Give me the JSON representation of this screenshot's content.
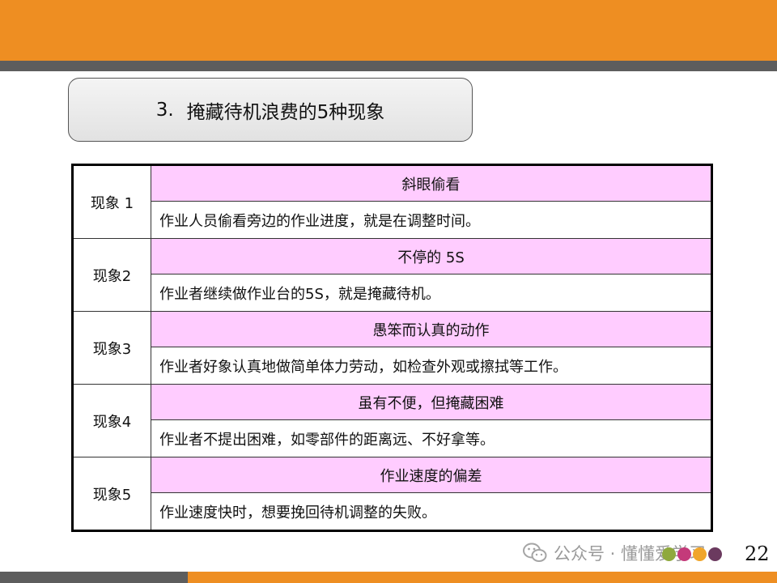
{
  "slide": {
    "title_number": "3.",
    "title": "掩藏待机浪费的5种现象",
    "page_number": "22"
  },
  "phenomena": [
    {
      "label": "现象 1",
      "heading": "斜眼偷看",
      "description": "作业人员偷看旁边的作业进度，就是在调整时间。"
    },
    {
      "label": "现象2",
      "heading": "不停的 5S",
      "description": "作业者继续做作业台的5S，就是掩藏待机。"
    },
    {
      "label": "现象3",
      "heading": "愚笨而认真的动作",
      "description": "作业者好象认真地做简单体力劳动，如检查外观或擦拭等工作。"
    },
    {
      "label": "现象4",
      "heading": "虽有不便，但掩藏困难",
      "description": "作业者不提出困难，如零部件的距离远、不好拿等。"
    },
    {
      "label": "现象5",
      "heading": "作业速度的偏差",
      "description": "作业速度快时，想要挽回待机调整的失败。"
    }
  ],
  "watermark": {
    "text": "公众号 · 懂懂爱学习",
    "icon": "wechat-icon"
  },
  "colors": {
    "band_orange": "#ee8e22",
    "band_gray": "#5d5d5d",
    "heading_fill": "#ffccff",
    "dots": [
      "#8fa93d",
      "#c43a7a",
      "#f0a52a",
      "#6b3a5f"
    ]
  }
}
